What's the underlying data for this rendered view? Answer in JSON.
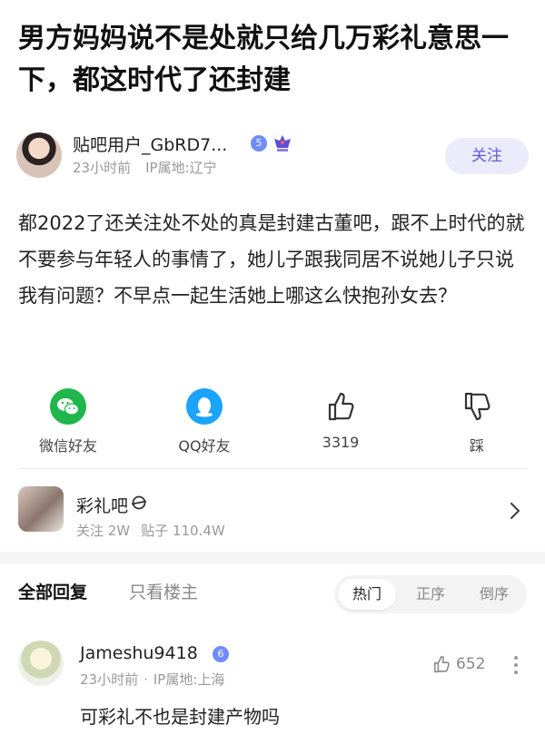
{
  "post": {
    "title": "男方妈妈说不是处就只给几万彩礼意思一下，都这时代了还封建",
    "author": {
      "name": "贴吧用户_GbRD7...",
      "level": "5",
      "time": "23小时前",
      "location": "IP属地:辽宁",
      "follow_label": "关注"
    },
    "body": "都2022了还关注处不处的真是封建古董吧，跟不上时代的就不要参与年轻人的事情了，她儿子跟我同居不说她儿子只说我有问题？不早点一起生活她上哪这么快抱孙女去？"
  },
  "share": [
    {
      "label": "微信好友",
      "icon": "wechat-icon"
    },
    {
      "label": "QQ好友",
      "icon": "qq-icon"
    },
    {
      "label": "3319",
      "icon": "thumbs-up-icon"
    },
    {
      "label": "踩",
      "icon": "thumbs-down-icon"
    }
  ],
  "forum": {
    "name": "彩礼吧",
    "followers": "关注 2W",
    "posts": "贴子 110.4W"
  },
  "replies": {
    "tab_all": "全部回复",
    "tab_op": "只看楼主",
    "sort": [
      "热门",
      "正序",
      "倒序"
    ],
    "sort_active": "热门"
  },
  "comment": {
    "username": "Jameshu9418",
    "level": "6",
    "time": "23小时前",
    "location": "IP属地:上海",
    "likes": "652",
    "text": "可彩礼不也是封建产物吗"
  },
  "colors": {
    "accent": "#5b5bd6",
    "follow_bg": "#ecebfb",
    "wechat": "#1fb74b",
    "qq": "#1aa3ff",
    "level_badge": "#6f8cff"
  }
}
